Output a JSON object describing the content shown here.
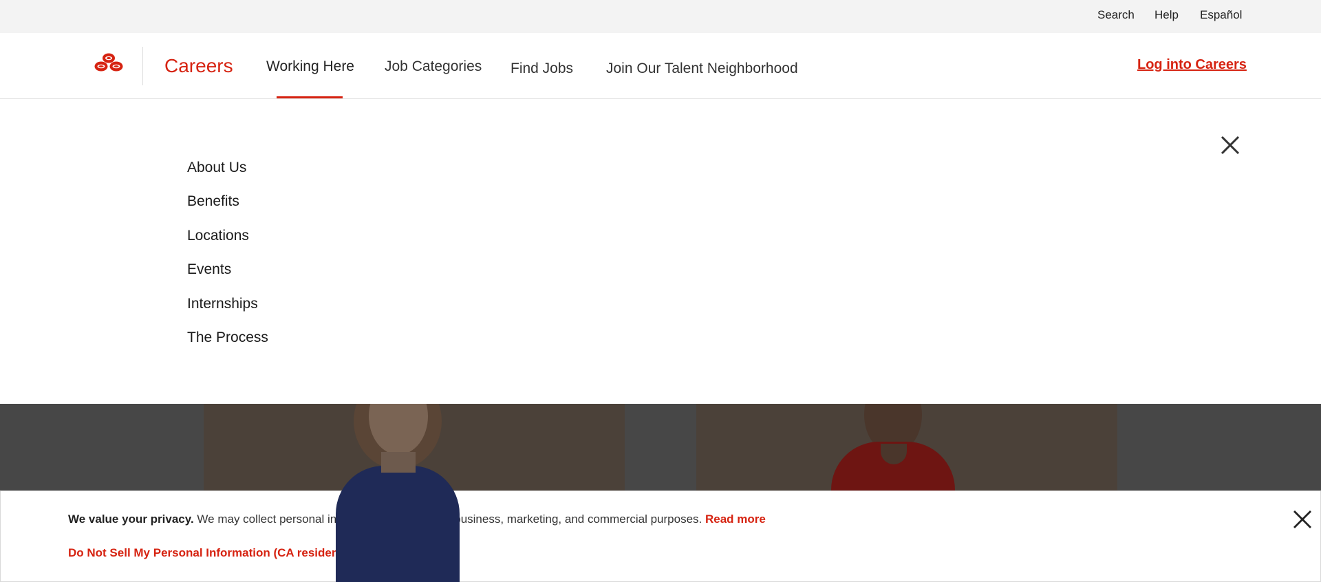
{
  "utility_nav": {
    "search": "Search",
    "help": "Help",
    "espanol": "Español"
  },
  "header": {
    "brand": "Careers",
    "nav": {
      "working_here": "Working Here",
      "job_categories": "Job Categories",
      "find_jobs": "Find Jobs",
      "talent_neighborhood": "Join Our Talent Neighborhood"
    },
    "active_nav": "Working Here",
    "login": "Log into Careers"
  },
  "dropdown": {
    "items": [
      "About Us",
      "Benefits",
      "Locations",
      "Events",
      "Internships",
      "The Process"
    ],
    "close_icon": "close-icon"
  },
  "privacy_banner": {
    "lead": "We value your privacy.",
    "text": " We may collect personal information from you for business, marketing, and commercial purposes. ",
    "read_more": "Read more",
    "opt_out": "Do Not Sell My Personal Information (CA residents only)",
    "close_icon": "close-icon"
  },
  "colors": {
    "brand_red": "#d62311",
    "utility_bar": "#f3f3f3",
    "overlay": "#474747"
  }
}
